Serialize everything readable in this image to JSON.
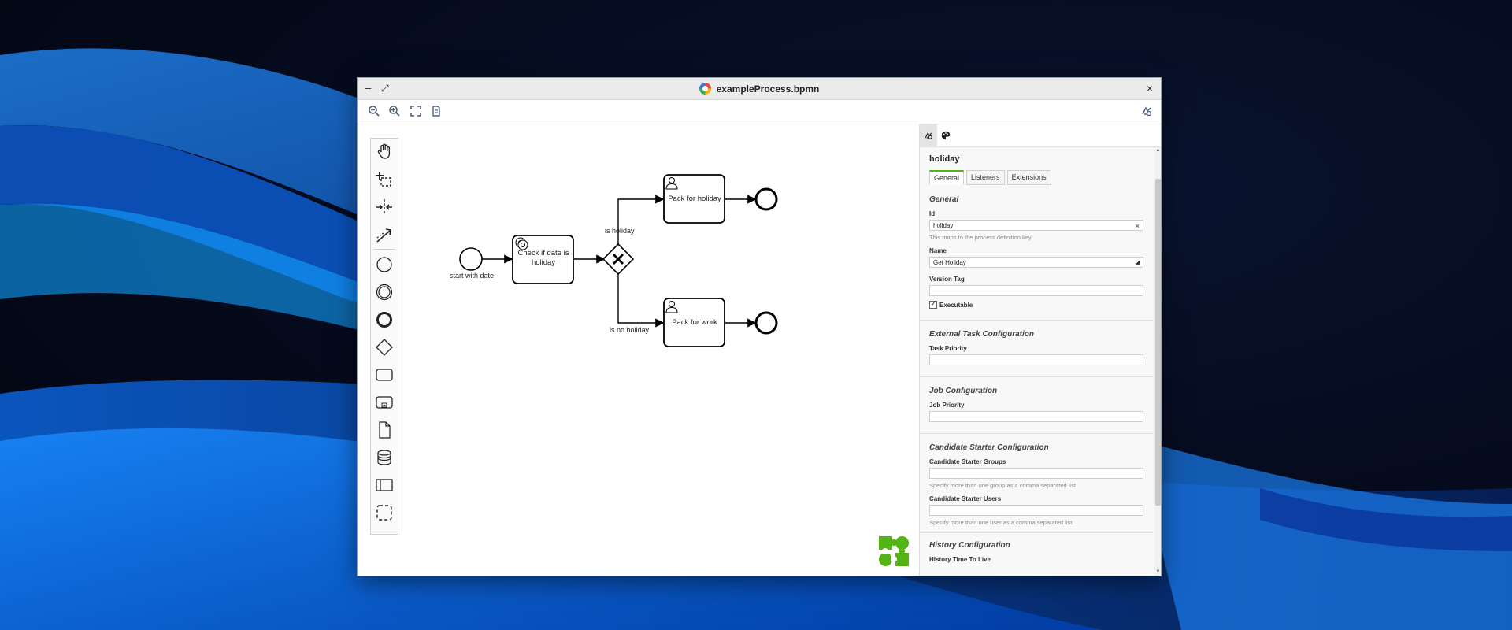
{
  "window": {
    "title": "exampleProcess.bpmn",
    "minimize": "–",
    "maximize": "⤢",
    "close": "×"
  },
  "toolbar": {
    "tools": [
      "zoom-out-icon",
      "zoom-in-icon",
      "fit-view-icon",
      "export-file-icon"
    ],
    "right_icon": "camunda-properties-icon"
  },
  "palette": {
    "tools": [
      "hand-tool-icon",
      "lasso-tool-icon",
      "space-tool-icon",
      "global-connect-tool-icon"
    ],
    "shapes": [
      "start-event-icon",
      "intermediate-event-icon",
      "end-event-icon",
      "gateway-icon",
      "task-icon",
      "subprocess-icon",
      "data-object-icon",
      "data-store-icon",
      "pool-icon",
      "group-icon"
    ]
  },
  "diagram": {
    "start_label": "start with date",
    "task_check": "Check if date is holiday",
    "task_holiday": "Pack for holiday",
    "task_work": "Pack for work",
    "flow_yes": "is holiday",
    "flow_no": "is no holiday"
  },
  "props": {
    "element_name": "holiday",
    "tabs": [
      "General",
      "Listeners",
      "Extensions"
    ],
    "general": {
      "group": "General",
      "id_label": "Id",
      "id_value": "holiday",
      "id_hint": "This maps to the process definition key.",
      "name_label": "Name",
      "name_value": "Get Holiday",
      "version_label": "Version Tag",
      "version_value": "",
      "executable_label": "Executable",
      "executable_checked": true
    },
    "external_task": {
      "group": "External Task Configuration",
      "priority_label": "Task Priority",
      "priority_value": ""
    },
    "job": {
      "group": "Job Configuration",
      "priority_label": "Job Priority",
      "priority_value": ""
    },
    "starter": {
      "group": "Candidate Starter Configuration",
      "groups_label": "Candidate Starter Groups",
      "groups_value": "",
      "groups_hint": "Specify more than one group as a comma separated list.",
      "users_label": "Candidate Starter Users",
      "users_value": "",
      "users_hint": "Specify more than one user as a comma separated list."
    },
    "history": {
      "group": "History Configuration",
      "ttl_label": "History Time To Live"
    }
  }
}
